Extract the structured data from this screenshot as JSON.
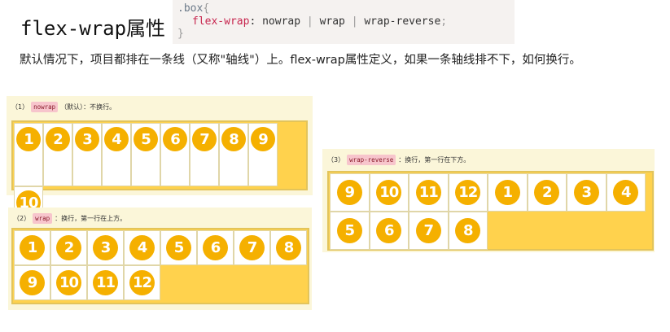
{
  "title": "flex-wrap属性",
  "code": {
    "selector": ".box",
    "open_brace": "{",
    "property": "flex-wrap",
    "colon": ":",
    "values": [
      "nowrap",
      "wrap",
      "wrap-reverse"
    ],
    "pipe": "|",
    "semicolon": ";",
    "close_brace": "}"
  },
  "description": "默认情况下，项目都排在一条线（又称\"轴线\"）上。flex-wrap属性定义，如果一条轴线排不下，如何换行。",
  "panels": [
    {
      "num": "（1）",
      "tag": "nowrap",
      "text": "（默认）：不换行。",
      "items": [
        "1",
        "2",
        "3",
        "4",
        "5",
        "6",
        "7",
        "8",
        "9",
        "10"
      ]
    },
    {
      "num": "（2）",
      "tag": "wrap",
      "text": "：换行，第一行在上方。",
      "items": [
        "1",
        "2",
        "3",
        "4",
        "5",
        "6",
        "7",
        "8",
        "9",
        "10",
        "11",
        "12"
      ]
    },
    {
      "num": "（3）",
      "tag": "wrap-reverse",
      "text": "：换行，第一行在下方。",
      "items": [
        "9",
        "10",
        "11",
        "12",
        "1",
        "2",
        "3",
        "4",
        "5",
        "6",
        "7",
        "8"
      ]
    }
  ]
}
